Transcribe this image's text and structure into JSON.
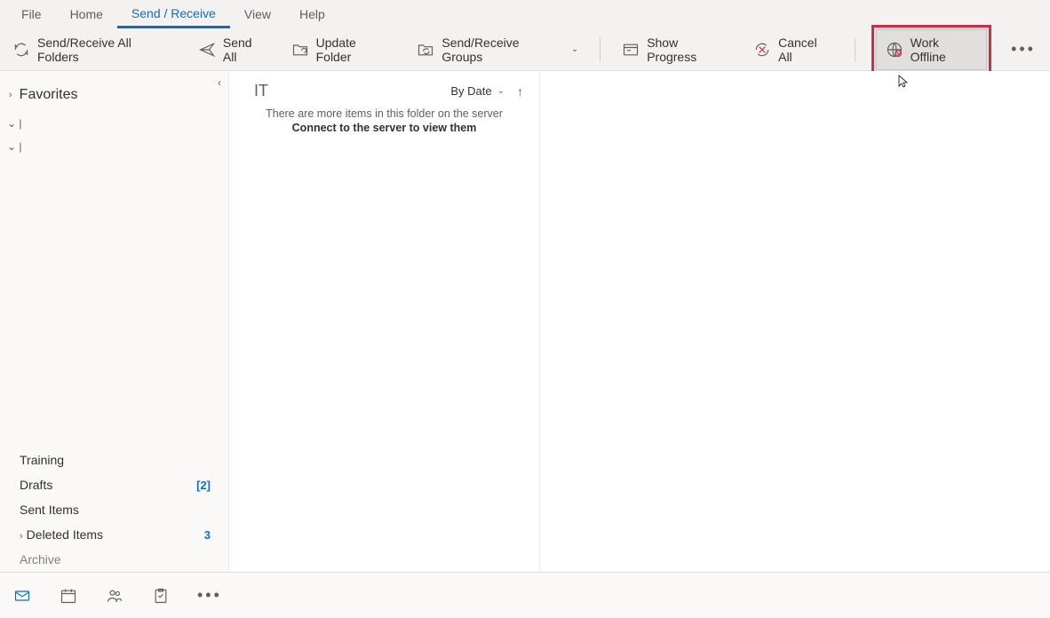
{
  "ribbon": {
    "tabs": [
      "File",
      "Home",
      "Send / Receive",
      "View",
      "Help"
    ],
    "active_tab_index": 2,
    "commands": {
      "send_receive_all": "Send/Receive All Folders",
      "send_all": "Send All",
      "update_folder": "Update Folder",
      "send_receive_groups": "Send/Receive Groups",
      "show_progress": "Show Progress",
      "cancel_all": "Cancel All",
      "work_offline": "Work Offline"
    }
  },
  "sidebar": {
    "favorites_label": "Favorites",
    "folders": {
      "training": "Training",
      "drafts": {
        "label": "Drafts",
        "count": "[2]"
      },
      "sent_items": "Sent Items",
      "deleted_items": {
        "label": "Deleted Items",
        "count": "3"
      },
      "archive": "Archive"
    }
  },
  "msglist": {
    "title": "IT",
    "sort_label": "By Date",
    "info_line1": "There are more items in this folder on the server",
    "info_line2": "Connect to the server to view them"
  }
}
